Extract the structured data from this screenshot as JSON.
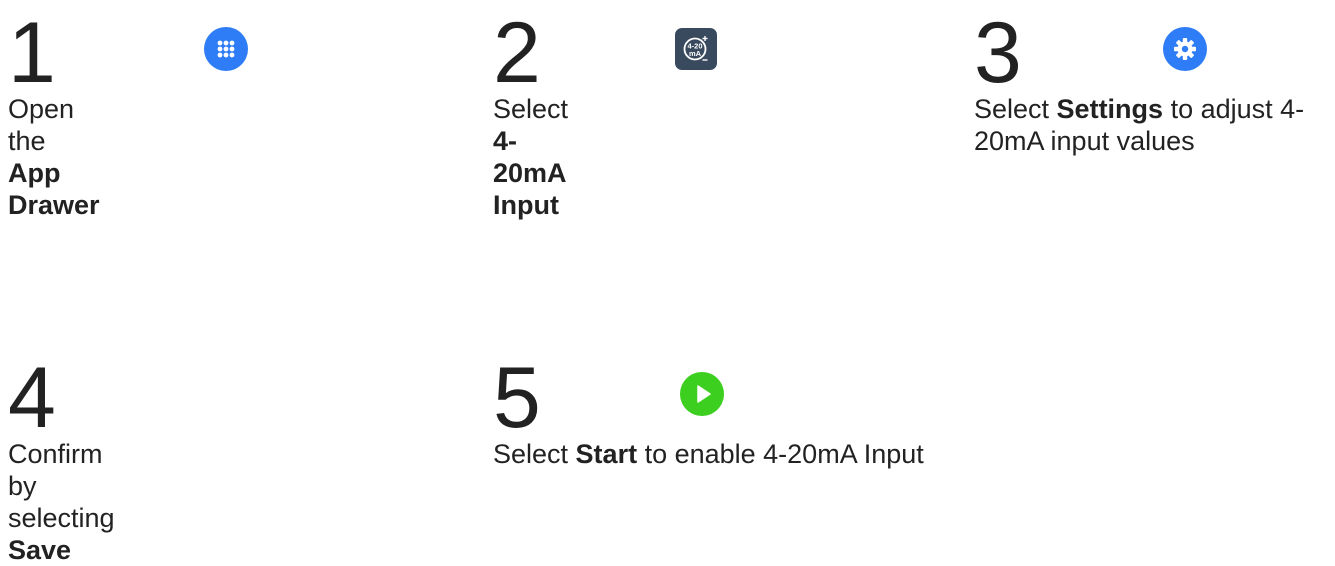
{
  "colors": {
    "text": "#222222",
    "app_drawer_blue": "#2f7df6",
    "settings_blue": "#2f7df6",
    "input_tile": "#3a4a5e",
    "start_green": "#3ccf1f"
  },
  "steps": [
    {
      "number": "1",
      "icon": "app-drawer-icon",
      "text_before": "Open the ",
      "text_bold": "App Drawer",
      "text_after": ""
    },
    {
      "number": "2",
      "icon": "4-20ma-input-icon",
      "icon_label_top": "4-20",
      "icon_label_bottom": "mA",
      "text_before": "Select ",
      "text_bold": "4-20mA Input",
      "text_after": ""
    },
    {
      "number": "3",
      "icon": "settings-gear-icon",
      "text_before": "Select ",
      "text_bold": "Settings",
      "text_after": " to adjust 4-20mA input values"
    },
    {
      "number": "4",
      "icon": "",
      "text_before": "Confirm by selecting ",
      "text_bold": "Save",
      "text_after": ""
    },
    {
      "number": "5",
      "icon": "start-play-icon",
      "text_before": "Select ",
      "text_bold": "Start",
      "text_after": " to enable 4-20mA Input"
    }
  ]
}
